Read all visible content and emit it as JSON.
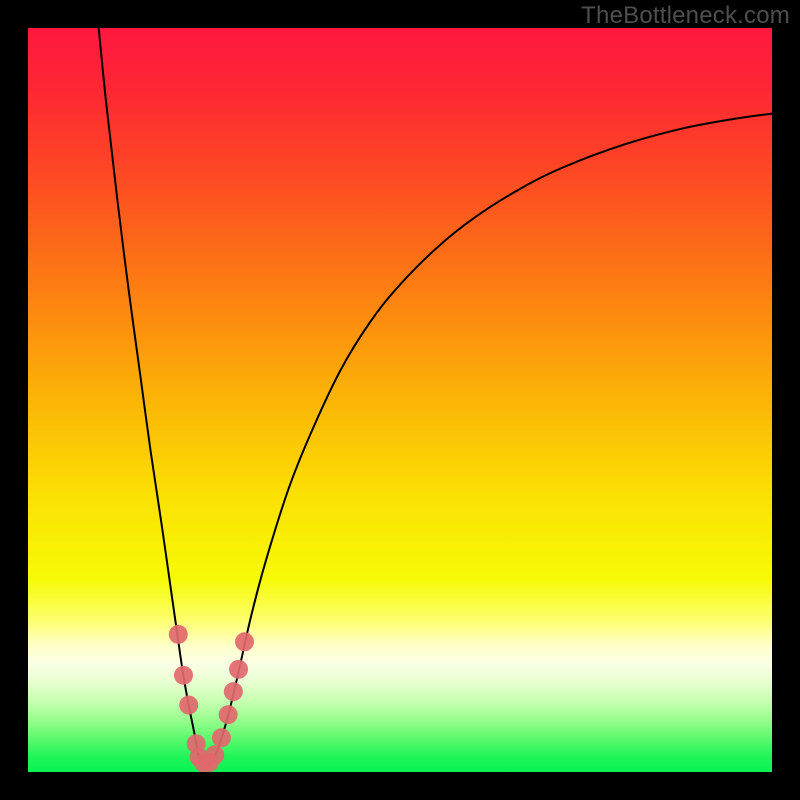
{
  "watermark": "TheBottleneck.com",
  "colors": {
    "frame": "#000000",
    "curve": "#000000",
    "marker_fill": "#e1686d",
    "marker_stroke": "#e1686d",
    "gradient_stops": [
      {
        "offset": 0.0,
        "color": "#fe183f"
      },
      {
        "offset": 0.08,
        "color": "#fe2634"
      },
      {
        "offset": 0.2,
        "color": "#fd4a23"
      },
      {
        "offset": 0.35,
        "color": "#fc7e12"
      },
      {
        "offset": 0.5,
        "color": "#fbb506"
      },
      {
        "offset": 0.63,
        "color": "#fbe103"
      },
      {
        "offset": 0.74,
        "color": "#f6fa06"
      },
      {
        "offset": 0.795,
        "color": "#fdff6b"
      },
      {
        "offset": 0.83,
        "color": "#ffffc9"
      },
      {
        "offset": 0.855,
        "color": "#faffe5"
      },
      {
        "offset": 0.88,
        "color": "#e7ffd1"
      },
      {
        "offset": 0.905,
        "color": "#c6ffb0"
      },
      {
        "offset": 0.93,
        "color": "#98fe8e"
      },
      {
        "offset": 0.955,
        "color": "#5df96e"
      },
      {
        "offset": 0.98,
        "color": "#1ef458"
      },
      {
        "offset": 1.0,
        "color": "#08f353"
      }
    ]
  },
  "chart_data": {
    "type": "line",
    "title": "",
    "xlabel": "",
    "ylabel": "",
    "xlim": [
      0,
      100
    ],
    "ylim": [
      0,
      100
    ],
    "grid": false,
    "legend": false,
    "series": [
      {
        "name": "bottleneck-curve",
        "x": [
          9.5,
          10.5,
          12,
          13.5,
          15,
          16.5,
          18,
          19,
          20,
          20.8,
          21.5,
          22.2,
          22.7,
          23,
          23.4,
          24,
          24.6,
          25.3,
          26,
          27,
          28.2,
          30,
          32,
          35,
          38,
          42,
          46,
          50,
          55,
          60,
          66,
          72,
          80,
          88,
          95,
          100
        ],
        "y": [
          100,
          90,
          77,
          65,
          54,
          43,
          33,
          26,
          19,
          13.5,
          9.5,
          6,
          3.5,
          2,
          1.3,
          1,
          1.3,
          2.5,
          4.5,
          8,
          13,
          21,
          28.5,
          38,
          45.5,
          54,
          60.5,
          65.5,
          70.5,
          74.5,
          78.3,
          81.3,
          84.3,
          86.5,
          87.8,
          88.5
        ]
      }
    ],
    "markers": {
      "name": "highlighted-points",
      "points": [
        {
          "x": 20.2,
          "y": 18.5
        },
        {
          "x": 20.9,
          "y": 13.0
        },
        {
          "x": 21.6,
          "y": 9.0
        },
        {
          "x": 22.6,
          "y": 3.8
        },
        {
          "x": 23.0,
          "y": 2.0
        },
        {
          "x": 23.6,
          "y": 1.2
        },
        {
          "x": 24.4,
          "y": 1.3
        },
        {
          "x": 25.1,
          "y": 2.3
        },
        {
          "x": 26.0,
          "y": 4.6
        },
        {
          "x": 26.9,
          "y": 7.7
        },
        {
          "x": 27.6,
          "y": 10.8
        },
        {
          "x": 28.3,
          "y": 13.8
        },
        {
          "x": 29.1,
          "y": 17.5
        }
      ]
    }
  }
}
